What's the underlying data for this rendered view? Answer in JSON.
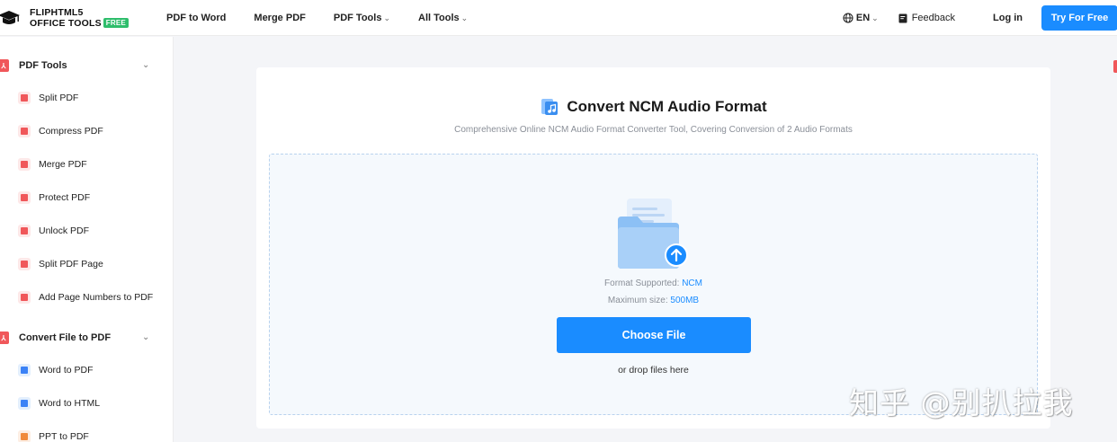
{
  "header": {
    "logo_line1": "FLIPHTML5",
    "logo_line2": "OFFICE TOOLS",
    "logo_badge": "FREE",
    "nav": [
      {
        "label": "PDF to Word",
        "dropdown": false
      },
      {
        "label": "Merge PDF",
        "dropdown": false
      },
      {
        "label": "PDF Tools",
        "dropdown": true
      },
      {
        "label": "All Tools",
        "dropdown": true
      }
    ],
    "language": "EN",
    "feedback": "Feedback",
    "login": "Log in",
    "try_free": "Try For Free"
  },
  "sidebar": {
    "sections": [
      {
        "label": "PDF Tools",
        "items": [
          "Split PDF",
          "Compress PDF",
          "Merge PDF",
          "Protect PDF",
          "Unlock PDF",
          "Split PDF Page",
          "Add Page Numbers to PDF"
        ]
      },
      {
        "label": "Convert File to PDF",
        "items": [
          "Word to PDF",
          "Word to HTML",
          "PPT to PDF"
        ]
      }
    ]
  },
  "main": {
    "title": "Convert NCM Audio Format",
    "subtitle": "Comprehensive Online NCM Audio Format Converter Tool, Covering Conversion of 2 Audio Formats",
    "format_label": "Format Supported:",
    "format_value": "NCM",
    "maxsize_label": "Maximum size:",
    "maxsize_value": "500MB",
    "choose_button": "Choose File",
    "drop_hint": "or drop files here"
  },
  "watermark": "知乎 @别扒拉我",
  "colors": {
    "accent": "#1a8cff",
    "pdf_red": "#f0575a",
    "badge_green": "#2ebd6b",
    "page_bg": "#f4f5f8"
  },
  "icons": [
    "graduation-cap-icon",
    "globe-icon",
    "chevron-down-icon",
    "feedback-icon",
    "pdf-icon",
    "music-file-icon",
    "upload-folder-icon",
    "upload-arrow-icon"
  ]
}
